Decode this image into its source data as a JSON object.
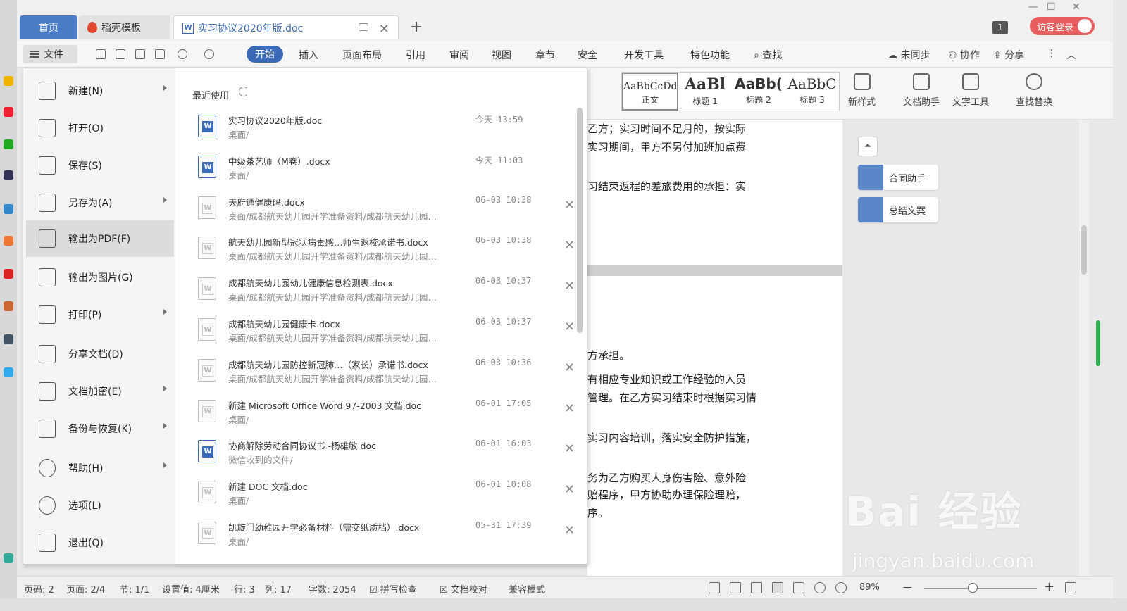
{
  "tabs": {
    "home": "首页",
    "template": "稻壳模板",
    "doc": "实习协议2020年版.doc",
    "plus": "+"
  },
  "window": {
    "badge": "1",
    "visitor_login": "访客登录",
    "min": "—",
    "max": "☐",
    "close": "✕"
  },
  "menubar": {
    "file": "文件",
    "items": [
      "开始",
      "插入",
      "页面布局",
      "引用",
      "审阅",
      "视图",
      "章节",
      "安全",
      "开发工具",
      "特色功能"
    ],
    "search": "查找",
    "sync": "未同步",
    "collab": "协作",
    "share": "分享"
  },
  "ribbon": {
    "styles": [
      {
        "preview": "AaBbCcDd",
        "name": "正文"
      },
      {
        "preview": "AaBl",
        "name": "标题 1"
      },
      {
        "preview": "AaBb(",
        "name": "标题 2"
      },
      {
        "preview": "AaBbC",
        "name": "标题 3"
      }
    ],
    "new_style": "新样式",
    "doc_helper": "文档助手",
    "text_tools": "文字工具",
    "find_replace": "查找替换"
  },
  "file_menu": {
    "items": [
      {
        "label": "新建(N)",
        "arrow": true
      },
      {
        "label": "打开(O)",
        "arrow": false
      },
      {
        "label": "保存(S)",
        "arrow": false
      },
      {
        "label": "另存为(A)",
        "arrow": true
      },
      {
        "label": "输出为PDF(F)",
        "arrow": false
      },
      {
        "label": "输出为图片(G)",
        "arrow": false
      },
      {
        "label": "打印(P)",
        "arrow": true
      },
      {
        "label": "分享文档(D)",
        "arrow": false
      },
      {
        "label": "文档加密(E)",
        "arrow": true
      },
      {
        "label": "备份与恢复(K)",
        "arrow": true
      },
      {
        "label": "帮助(H)",
        "arrow": true
      },
      {
        "label": "选项(L)",
        "arrow": false
      },
      {
        "label": "退出(Q)",
        "arrow": false
      }
    ],
    "recent_title": "最近使用",
    "recent": [
      {
        "name": "实习协议2020年版.doc",
        "path": "桌面/",
        "time": "今天 13:59",
        "hot": true
      },
      {
        "name": "中级茶艺师（M卷）.docx",
        "path": "桌面/",
        "time": "今天 11:03",
        "hot": true
      },
      {
        "name": "天府通健康码.docx",
        "path": "桌面/成都航天幼儿园开学准备资料/成都航天幼儿园…",
        "time": "06-03 10:38",
        "hot": false
      },
      {
        "name": "航天幼儿园新型冠状病毒感…师生返校承诺书.docx",
        "path": "桌面/成都航天幼儿园开学准备资料/成都航天幼儿园…",
        "time": "06-03 10:38",
        "hot": false
      },
      {
        "name": "成都航天幼儿园幼儿健康信息检测表.docx",
        "path": "桌面/成都航天幼儿园开学准备资料/成都航天幼儿园…",
        "time": "06-03 10:37",
        "hot": false
      },
      {
        "name": "成都航天幼儿园健康卡.docx",
        "path": "桌面/成都航天幼儿园开学准备资料/成都航天幼儿园…",
        "time": "06-03 10:37",
        "hot": false
      },
      {
        "name": "成都航天幼儿园防控新冠肺…（家长）承诺书.docx",
        "path": "桌面/成都航天幼儿园开学准备资料/成都航天幼儿园…",
        "time": "06-03 10:36",
        "hot": false
      },
      {
        "name": "新建 Microsoft Office Word 97-2003 文档.doc",
        "path": "桌面/",
        "time": "06-01 17:05",
        "hot": false
      },
      {
        "name": "协商解除劳动合同协议书 -杨雄敏.doc",
        "path": "微信收到的文件/",
        "time": "06-01 16:03",
        "hot": true
      },
      {
        "name": "新建 DOC 文档.doc",
        "path": "桌面/",
        "time": "06-01 10:08",
        "hot": false
      },
      {
        "name": "凯旋门幼稚园开学必备材料（需交纸质档）.docx",
        "path": "桌面/",
        "time": "05-31 17:39",
        "hot": false
      }
    ],
    "remove": "✕"
  },
  "document": {
    "lines": [
      "乙方；实习时间不足月的，按实际",
      "实习期间，甲方不另付加班加点费",
      "习结束返程的差旅费用的承担：实",
      "方承担。",
      "有相应专业知识或工作经验的人员",
      "管理。在乙方实习结束时根据实习情",
      "实习内容培训，落实安全防护措施，",
      "务为乙方购买人身伤害险、意外险",
      "赔程序，甲方协助办理保险理赔，",
      "序。"
    ]
  },
  "right_pane": {
    "contract_helper": "合同助手",
    "summary_copy": "总结文案"
  },
  "status": {
    "page_code": "页码: 2",
    "page": "页面: 2/4",
    "section": "节: 1/1",
    "setting": "设置值: 4厘米",
    "row": "行: 3",
    "col": "列: 17",
    "words": "字数: 2054",
    "spell": "拼写检查",
    "proof": "文档校对",
    "compat": "兼容模式",
    "zoom": "89%",
    "zoom_minus": "—",
    "zoom_plus": "+"
  },
  "watermark": {
    "brand": "Bai 经验",
    "url": "jingyan.baidu.com"
  }
}
